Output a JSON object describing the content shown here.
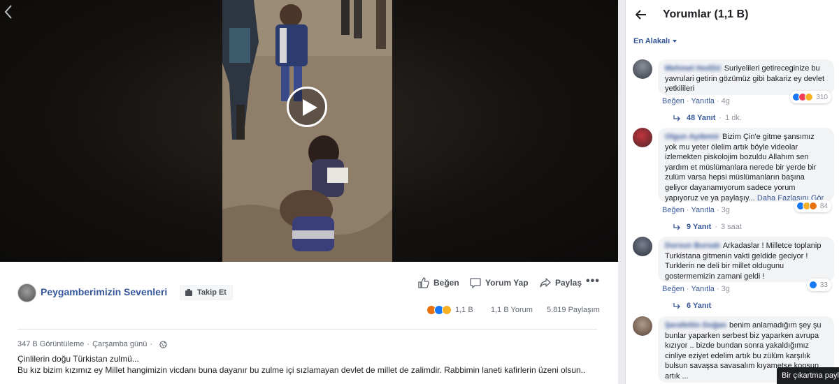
{
  "post": {
    "page_name": "Peygamberimizin Sevenleri",
    "follow_label": "Takip Et",
    "actions": {
      "like": "Beğen",
      "comment": "Yorum Yap",
      "share": "Paylaş",
      "more": "•••"
    },
    "stats": {
      "reactions": "1,1 B",
      "comments": "1,1 B Yorum",
      "shares": "5.819 Paylaşım"
    },
    "meta": {
      "views": "347 B Görüntüleme",
      "separator": "·",
      "date": "Çarşamba günü",
      "separator2": "·"
    },
    "description": "Çinlilerin doğu Türkistan zulmü...\nBu kız bizim kızımız ey Millet hangimizin vicdanı buna dayanır bu zulme içi sızlamayan devlet de millet de zalimdir. Rabbimin laneti kafirlerin üzeni olsun.."
  },
  "pane": {
    "title": "Yorumlar (1,1 B)",
    "sort_label": "En Alakalı",
    "comments": [
      {
        "author": "Mehmet Hodžić",
        "text": "Suriyelileri getireceginize bu yavrulari getirin gözümüz gibi bakariz ey devlet yetkilileri",
        "like": "Beğen",
        "reply": "Yanıtla",
        "dot": "·",
        "time": "4g",
        "reactions_count": "310",
        "replies": "48 Yanıt",
        "replies_dot": "·",
        "replies_time": "1 dk."
      },
      {
        "author": "Olgun Aydemir",
        "text": "Bizim Çin'e gitme şansımız yok mu yeter ölelim artık böyle videolar izlemekten piskolojim bozuldu Allahım sen yardım et müslümanlara nerede bir yerde bir zulüm varsa hepsi müslümanların başına geliyor dayanamıyorum sadece yorum yapıyoruz ve ya paylaşıy...",
        "more": "Daha Fazlasını Gör",
        "like": "Beğen",
        "reply": "Yanıtla",
        "dot": "·",
        "time": "3g",
        "reactions_count": "84",
        "replies": "9 Yanıt",
        "replies_dot": "·",
        "replies_time": "3 saat"
      },
      {
        "author": "Dursun Bursalı",
        "text": "Arkadaslar ! Milletce toplanip Turkistana gitmenin vakti geldide geciyor ! Turklerin ne deli bir millet oldugunu gostermemizin zamani geldi !",
        "like": "Beğen",
        "reply": "Yanıtla",
        "dot": "·",
        "time": "3g",
        "reactions_count": "33",
        "replies": "6 Yanıt"
      },
      {
        "author": "Şerafettin Doğan",
        "text": "benim anlamadığım şey şu bunlar yaparken serbest biz yaparken avrupa kızıyor .. bizde bundan sonra yakaldığımız cinliye eziyet edelim artık bu zülüm karşılık bulsun savaşsa savasalım kıyametse kopsun artık ..."
      }
    ]
  },
  "toast": "Bir çıkartma paylaş",
  "colors": {
    "link": "#365899",
    "like_blue": "#1877f2",
    "angry": "#e9710f",
    "sad": "#f7b125",
    "love": "#f33e58"
  },
  "icons": [
    "chevron-left-icon",
    "play-icon",
    "follow-icon",
    "like-thumb-icon",
    "comment-icon",
    "share-arrow-icon",
    "more-dots-icon",
    "globe-icon",
    "back-arrow-icon",
    "reply-arrow-icon"
  ]
}
